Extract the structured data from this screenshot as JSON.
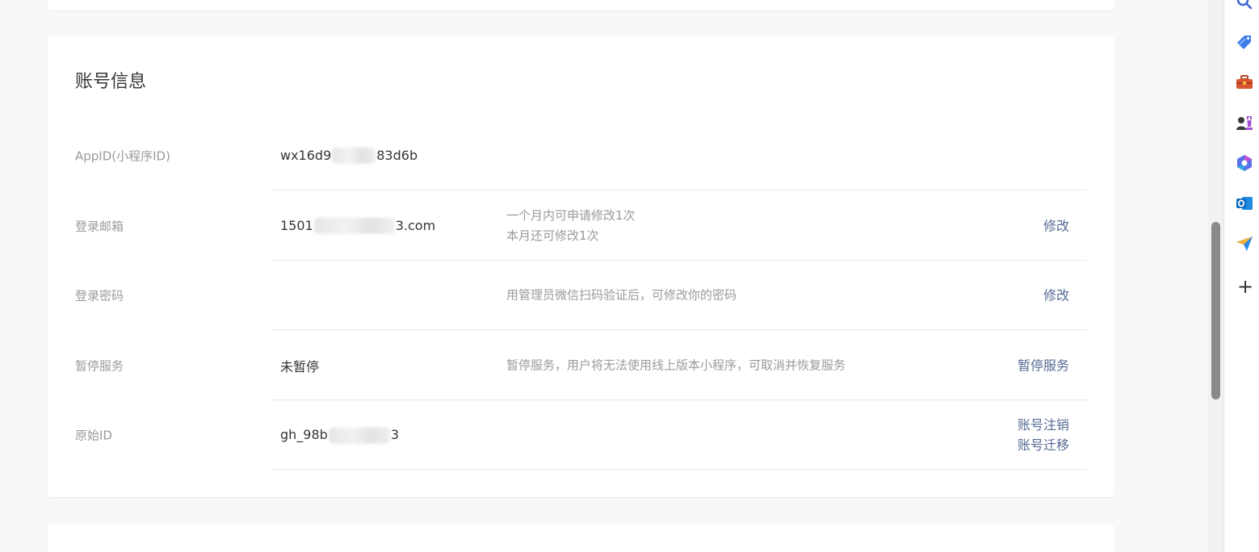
{
  "card": {
    "title": "账号信息"
  },
  "rows": {
    "appid": {
      "label": "AppID(小程序ID)",
      "value_start": "wx16d9",
      "value_end": "83d6b"
    },
    "email": {
      "label": "登录邮箱",
      "value_start": "1501",
      "value_end": "3.com",
      "desc_line1": "一个月内可申请修改1次",
      "desc_line2": "本月还可修改1次",
      "action": "修改"
    },
    "password": {
      "label": "登录密码",
      "desc": "用管理员微信扫码验证后，可修改你的密码",
      "action": "修改"
    },
    "suspend": {
      "label": "暂停服务",
      "value": "未暂停",
      "desc": "暂停服务，用户将无法使用线上版本小程序，可取消并恢复服务",
      "action": "暂停服务"
    },
    "original": {
      "label": "原始ID",
      "value_start": "gh_98b",
      "value_end": "3",
      "action1": "账号注销",
      "action2": "账号迁移"
    }
  },
  "colors": {
    "link": "#576b95",
    "label": "#9a9a9a",
    "text": "#353535",
    "background": "#f7f8fa"
  },
  "sidebar_icons": [
    "search-icon",
    "tag-icon",
    "toolbox-icon",
    "chess-icon",
    "copilot-icon",
    "outlook-icon",
    "send-icon",
    "add-icon"
  ],
  "sidebar": {
    "plus": "+"
  }
}
